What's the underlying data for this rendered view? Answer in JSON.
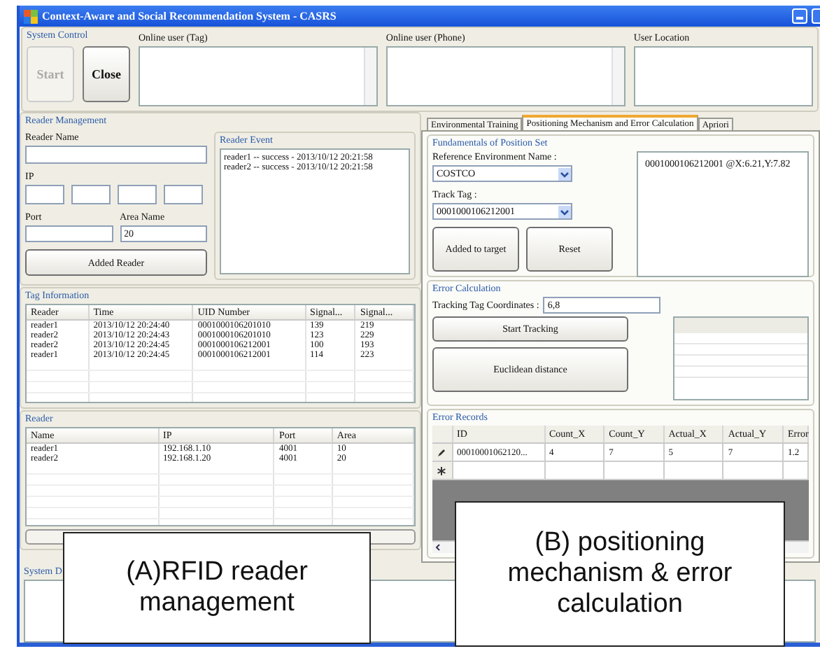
{
  "window": {
    "title": "Context-Aware and Social Recommendation System - CASRS"
  },
  "system_control": {
    "title": "System Control",
    "buttons": [
      {
        "label": "Start",
        "disabled": true
      },
      {
        "label": "Close",
        "disabled": false
      }
    ],
    "panels": [
      {
        "label": "Online user (Tag)",
        "scrollable": true
      },
      {
        "label": "Online user (Phone)",
        "scrollable": true
      },
      {
        "label": "User Location",
        "scrollable": false
      }
    ]
  },
  "reader_management": {
    "title": "Reader Management",
    "reader_name_label": "Reader Name",
    "ip_label": "IP",
    "port_label": "Port",
    "area_label": "Area Name",
    "area_value": "20",
    "add_button": "Added Reader",
    "event_title": "Reader Event",
    "events": [
      "reader1 -- success - 2013/10/12 20:21:58",
      "reader2 -- success - 2013/10/12 20:21:58"
    ]
  },
  "tag_information": {
    "title": "Tag Information",
    "columns": [
      "Reader",
      "Time",
      "UID Number",
      "Signal...",
      "Signal..."
    ],
    "rows": [
      [
        "reader1",
        "2013/10/12 20:24:40",
        "0001000106201010",
        "139",
        "219"
      ],
      [
        "reader2",
        "2013/10/12 20:24:43",
        "0001000106201010",
        "123",
        "229"
      ],
      [
        "reader2",
        "2013/10/12 20:24:45",
        "0001000106212001",
        "100",
        "193"
      ],
      [
        "reader1",
        "2013/10/12 20:24:45",
        "0001000106212001",
        "114",
        "223"
      ]
    ]
  },
  "reader": {
    "title": "Reader",
    "columns": [
      "Name",
      "IP",
      "Port",
      "Area"
    ],
    "rows": [
      [
        "reader1",
        "192.168.1.10",
        "4001",
        "10"
      ],
      [
        "reader2",
        "192.168.1.20",
        "4001",
        "20"
      ]
    ]
  },
  "tabs": [
    {
      "label": "Environmental Training",
      "selected": false
    },
    {
      "label": "Positioning Mechanism and Error Calculation",
      "selected": true
    },
    {
      "label": "Apriori",
      "selected": false
    }
  ],
  "position_set": {
    "title": "Fundamentals of Position Set",
    "reference_label": "Reference Environment Name :",
    "reference_value": "COSTCO",
    "track_label": "Track Tag :",
    "track_value": "0001000106212001",
    "buttons": [
      "Added to target",
      "Reset"
    ],
    "output": "0001000106212001 @X:6.21,Y:7.82"
  },
  "error_calculation": {
    "title": "Error Calculation",
    "coords_label": "Tracking Tag Coordinates :",
    "coords_value": "6,8",
    "buttons": [
      "Start Tracking",
      "Euclidean distance"
    ]
  },
  "error_records": {
    "title": "Error Records",
    "columns": [
      "ID",
      "Count_X",
      "Count_Y",
      "Actual_X",
      "Actual_Y",
      "Error"
    ],
    "rows": [
      {
        "kind": "edit",
        "cells": [
          "00010001062120...",
          "4",
          "7",
          "5",
          "7",
          "1.2"
        ]
      },
      {
        "kind": "new"
      }
    ]
  },
  "system_display": {
    "label": "System D"
  },
  "captions": [
    "(A)RFID reader management",
    "(B) positioning mechanism & error calculation"
  ]
}
